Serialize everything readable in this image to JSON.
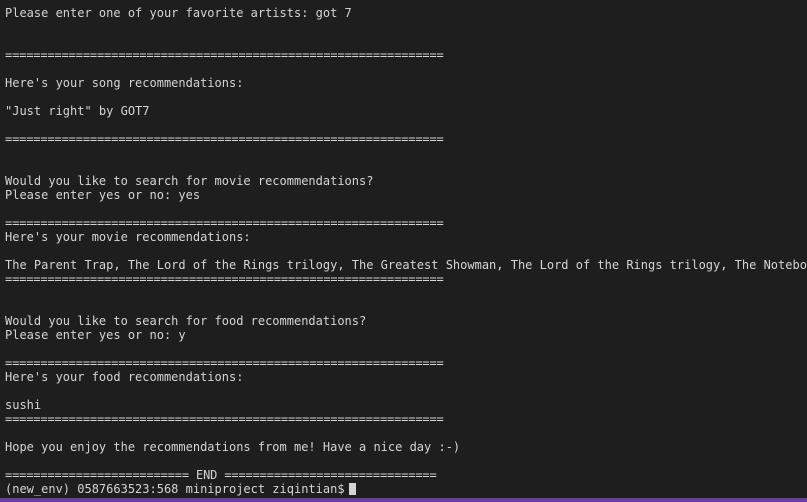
{
  "lines": {
    "l1": "Please enter one of your favorite artists: got 7",
    "sep1": "==============================================================",
    "l2": "Here's your song recommendations:",
    "l3": "\"Just right\" by GOT7",
    "sep2": "==============================================================",
    "l4": "Would you like to search for movie recommendations?",
    "l5": "Please enter yes or no: yes",
    "sep3": "==============================================================",
    "l6": "Here's your movie recommendations:",
    "l7": "The Parent Trap, The Lord of the Rings trilogy, The Greatest Showman, The Lord of the Rings trilogy, The Notebook",
    "sep4": "==============================================================",
    "l8": "Would you like to search for food recommendations?",
    "l9": "Please enter yes or no: y",
    "sep5": "==============================================================",
    "l10": "Here's your food recommendations:",
    "l11": "sushi",
    "sep6": "==============================================================",
    "l12": "Hope you enjoy the recommendations from me! Have a nice day :-)",
    "end": "========================== END =============================="
  },
  "prompt": {
    "text": "(new_env) 0587663523:568 miniproject ziqintian$"
  }
}
